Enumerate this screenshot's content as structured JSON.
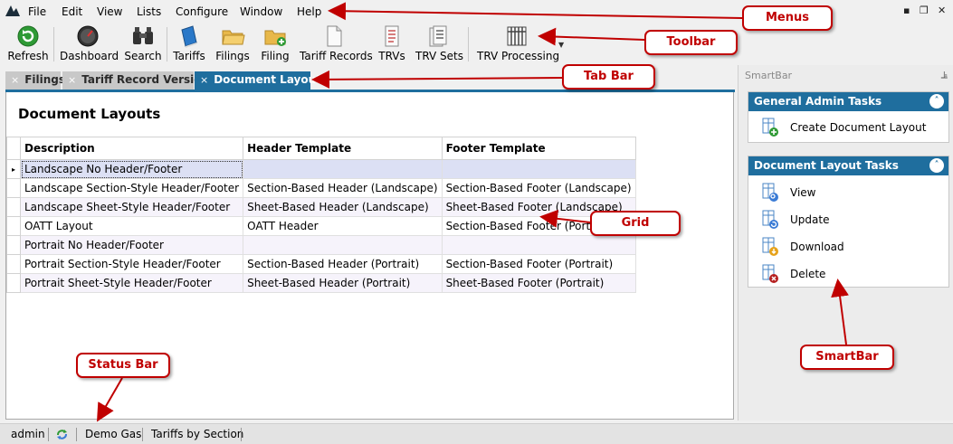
{
  "menus": [
    "File",
    "Edit",
    "View",
    "Lists",
    "Configure",
    "Window",
    "Help"
  ],
  "window_controls": [
    "▪",
    "❐",
    "✕"
  ],
  "toolbar": {
    "refresh": "Refresh",
    "dashboard": "Dashboard",
    "search": "Search",
    "tariffs": "Tariffs",
    "filings": "Filings",
    "filing": "Filing",
    "tariff_records": "Tariff Records",
    "trvs": "TRVs",
    "trv_sets": "TRV Sets",
    "trv_processing": "TRV Processing"
  },
  "tabs": [
    {
      "label": "Filings",
      "close": "×",
      "active": false
    },
    {
      "label": "Tariff Record Versions",
      "close": "×",
      "active": false
    },
    {
      "label": "Document Layouts",
      "close": "×",
      "active": true
    }
  ],
  "page": {
    "title": "Document Layouts"
  },
  "grid": {
    "columns": [
      "Description",
      "Header Template",
      "Footer Template"
    ],
    "rows": [
      [
        "Landscape No Header/Footer",
        "",
        ""
      ],
      [
        "Landscape Section-Style Header/Footer",
        "Section-Based Header (Landscape)",
        "Section-Based Footer (Landscape)"
      ],
      [
        "Landscape Sheet-Style Header/Footer",
        "Sheet-Based Header (Landscape)",
        "Sheet-Based Footer (Landscape)"
      ],
      [
        "OATT Layout",
        "OATT Header",
        "Section-Based Footer (Portrait)"
      ],
      [
        "Portrait No Header/Footer",
        "",
        ""
      ],
      [
        "Portrait Section-Style Header/Footer",
        "Section-Based Header (Portrait)",
        "Section-Based Footer (Portrait)"
      ],
      [
        "Portrait Sheet-Style Header/Footer",
        "Sheet-Based Header (Portrait)",
        "Sheet-Based Footer (Portrait)"
      ]
    ],
    "selected_row_marker": "▸"
  },
  "smartbar": {
    "title": "SmartBar",
    "pin": "⫡",
    "general": {
      "title": "General Admin Tasks",
      "tasks": [
        "Create Document Layout"
      ]
    },
    "layout": {
      "title": "Document Layout Tasks",
      "tasks": [
        "View",
        "Update",
        "Download",
        "Delete"
      ]
    },
    "collapse_glyph": "˄"
  },
  "status": {
    "user": "admin",
    "company": "Demo Gas",
    "mode": "Tariffs by Section"
  },
  "annotations": {
    "menus": "Menus",
    "toolbar": "Toolbar",
    "tab_bar": "Tab Bar",
    "grid": "Grid",
    "status_bar": "Status Bar",
    "smartbar": "SmartBar"
  },
  "colors": {
    "accent": "#1f6e9e",
    "annotation": "#c00000",
    "selected_row": "#dce0f4",
    "alt_row": "#f6f3fb"
  }
}
